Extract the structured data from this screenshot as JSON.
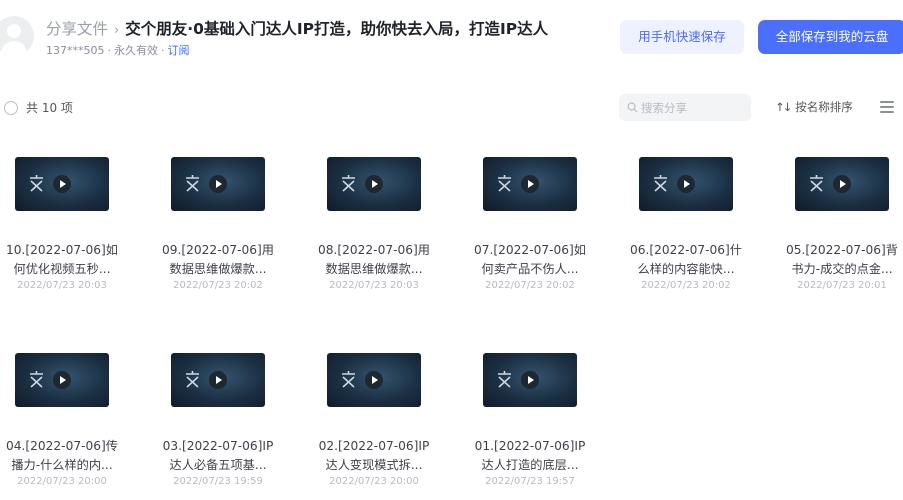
{
  "header": {
    "crumb": "分享文件",
    "title": "交个朋友·0基础入门达人IP打造，助你快去入局，打造IP达人",
    "user": "137***505",
    "validity": "永久有效",
    "subscribe": "订阅",
    "btn_phone": "用手机快速保存",
    "btn_save_all": "全部保存到我的云盘"
  },
  "toolbar": {
    "count": "共 10 项",
    "search_placeholder": "搜索分享",
    "sort_label": "按名称排序"
  },
  "files": [
    {
      "line1": "10.[2022-07-06]如",
      "line2": "何优化视频五秒...",
      "date": "2022/07/23 20:03"
    },
    {
      "line1": "09.[2022-07-06]用",
      "line2": "数据思维做爆款...",
      "date": "2022/07/23 20:02"
    },
    {
      "line1": "08.[2022-07-06]用",
      "line2": "数据思维做爆款...",
      "date": "2022/07/23 20:03"
    },
    {
      "line1": "07.[2022-07-06]如",
      "line2": "何卖产品不伤人...",
      "date": "2022/07/23 20:02"
    },
    {
      "line1": "06.[2022-07-06]什",
      "line2": "么样的内容能快...",
      "date": "2022/07/23 20:02"
    },
    {
      "line1": "05.[2022-07-06]背",
      "line2": "书力-成交的点金...",
      "date": "2022/07/23 20:01"
    },
    {
      "line1": "04.[2022-07-06]传",
      "line2": "播力-什么样的内...",
      "date": "2022/07/23 20:00"
    },
    {
      "line1": "03.[2022-07-06]IP",
      "line2": "达人必备五项基...",
      "date": "2022/07/23 19:59"
    },
    {
      "line1": "02.[2022-07-06]IP",
      "line2": "达人变现模式拆...",
      "date": "2022/07/23 20:00"
    },
    {
      "line1": "01.[2022-07-06]IP",
      "line2": "达人打造的底层...",
      "date": "2022/07/23 19:57"
    }
  ]
}
